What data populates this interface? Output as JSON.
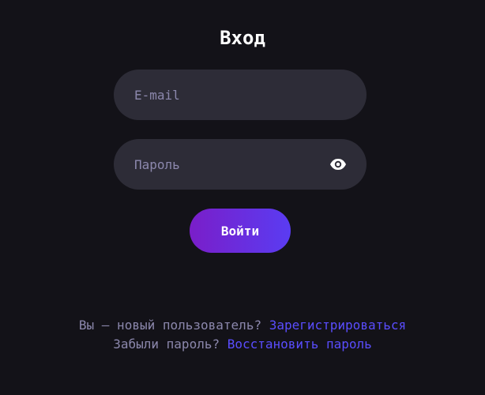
{
  "login": {
    "title": "Вход",
    "email_placeholder": "E-mail",
    "password_placeholder": "Пароль",
    "submit_label": "Войти"
  },
  "footer": {
    "new_user_text": "Вы — новый пользователь?",
    "register_link": "Зарегистрироваться",
    "forgot_text": "Забыли пароль?",
    "restore_link": "Восстановить пароль"
  },
  "icons": {
    "password_toggle": "eye-icon"
  },
  "colors": {
    "background": "#131218",
    "field_background": "#2d2c37",
    "placeholder": "#8c88ad",
    "link": "#5a4dff",
    "button_gradient_start": "#7a1ec9",
    "button_gradient_end": "#5a3cf2"
  }
}
